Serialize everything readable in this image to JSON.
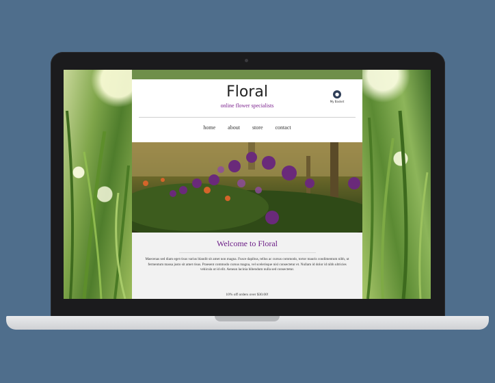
{
  "site": {
    "logo": "Floral",
    "tagline": "online flower specialists",
    "basket_label": "My Basket",
    "nav": [
      "home",
      "about",
      "store",
      "contact"
    ],
    "welcome_heading": "Welcome to Floral",
    "body_text": "Maecenas sed diam eget risus varius blandit sit amet non magna. Fusce dapibus, tellus ac cursus commodo, tortor mauris condimentum nibh, ut fermentum massa justo sit amet risus. Praesent commodo cursus magna, vel scelerisque nisl consectetur et. Nullam id dolor id nibh ultricies vehicula ut id elit. Aenean lacinia bibendum nulla sed consectetur.",
    "offer_text": "10% off orders over $30.00!"
  },
  "colors": {
    "page_background": "#4f6e8c",
    "accent_purple": "#6b1d86",
    "basket_icon": "#2f3e58"
  },
  "icons": {
    "basket": "basket-icon"
  }
}
